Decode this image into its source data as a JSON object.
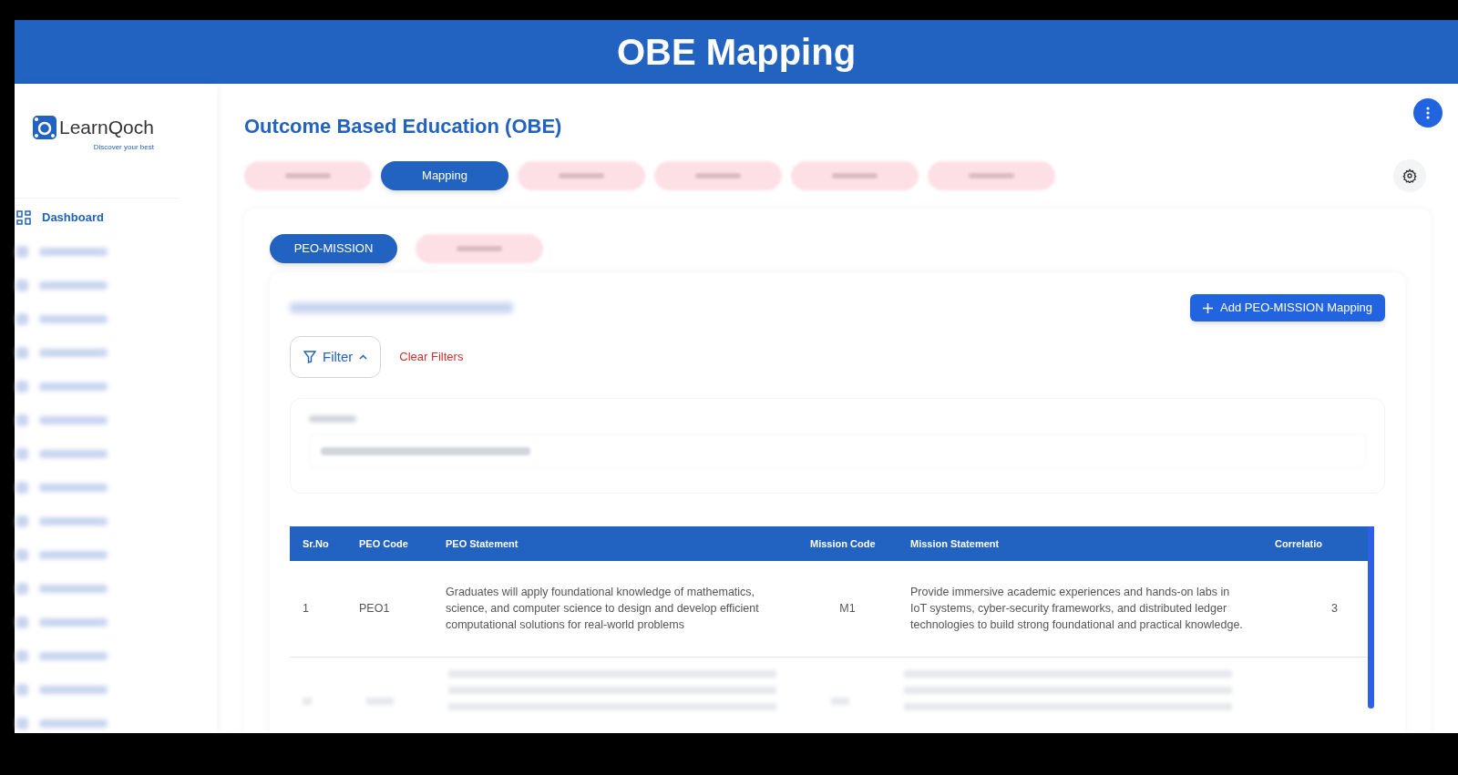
{
  "banner": {
    "title": "OBE Mapping"
  },
  "logo": {
    "name": "LearnQoch",
    "tagline": "Discover your best"
  },
  "sidebar": {
    "items": [
      {
        "label": "Dashboard",
        "selected": true
      },
      {
        "selected": false
      },
      {
        "selected": false
      },
      {
        "selected": false
      },
      {
        "selected": false
      },
      {
        "selected": false
      },
      {
        "selected": false
      },
      {
        "selected": false
      },
      {
        "selected": false
      },
      {
        "selected": false
      },
      {
        "selected": false
      },
      {
        "selected": false
      },
      {
        "selected": false
      },
      {
        "selected": false
      },
      {
        "selected": false
      },
      {
        "selected": false
      }
    ]
  },
  "page_title": "Outcome Based Education (OBE)",
  "module_tabs": [
    {
      "selected": false
    },
    {
      "label": "Mapping",
      "selected": true
    },
    {
      "selected": false
    },
    {
      "selected": false
    },
    {
      "selected": false
    },
    {
      "selected": false
    }
  ],
  "mapping_tabs": [
    {
      "label": "PEO-MISSION",
      "selected": true
    },
    {
      "selected": false
    }
  ],
  "add_button": "Add PEO-MISSION Mapping",
  "filter": {
    "label": "Filter",
    "expanded": true,
    "clear": "Clear Filters"
  },
  "table": {
    "columns": [
      "Sr.No",
      "PEO Code",
      "PEO Statement",
      "Mission Code",
      "Mission Statement",
      "Correlatio"
    ],
    "rows": [
      {
        "cells": [
          "1",
          "PEO1",
          "Graduates will apply foundational knowledge of mathematics, science, and computer science to design and develop efficient computational solutions for real-world problems",
          "M1",
          "Provide immersive academic experiences and hands-on labs in IoT systems, cyber-security frameworks, and distributed ledger technologies to build strong foundational and practical knowledge.",
          "3"
        ]
      }
    ]
  }
}
